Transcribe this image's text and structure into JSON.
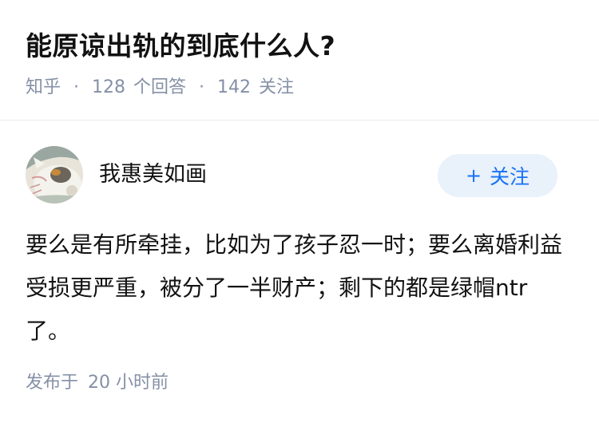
{
  "question": {
    "title": "能原谅出轨的到底什么人?",
    "source": "知乎",
    "answer_count": "128",
    "answer_label": "个回答",
    "follower_count": "142",
    "follower_label": "关注",
    "separator": "·"
  },
  "author": {
    "name": "我惠美如画",
    "follow_label": "关注",
    "follow_icon": "+",
    "follow_color": "#1772f6",
    "follow_bg": "#e9f1fb"
  },
  "answer": {
    "text": "要么是有所牵挂，比如为了孩子忍一时；要么离婚利益受损更严重，被分了一半财产；剩下的都是绿帽ntr了。",
    "published_label": "发布于",
    "published_time": "20 小时前"
  },
  "colors": {
    "text_primary": "#121212",
    "text_secondary": "#8590a6",
    "divider": "#ebebeb"
  }
}
